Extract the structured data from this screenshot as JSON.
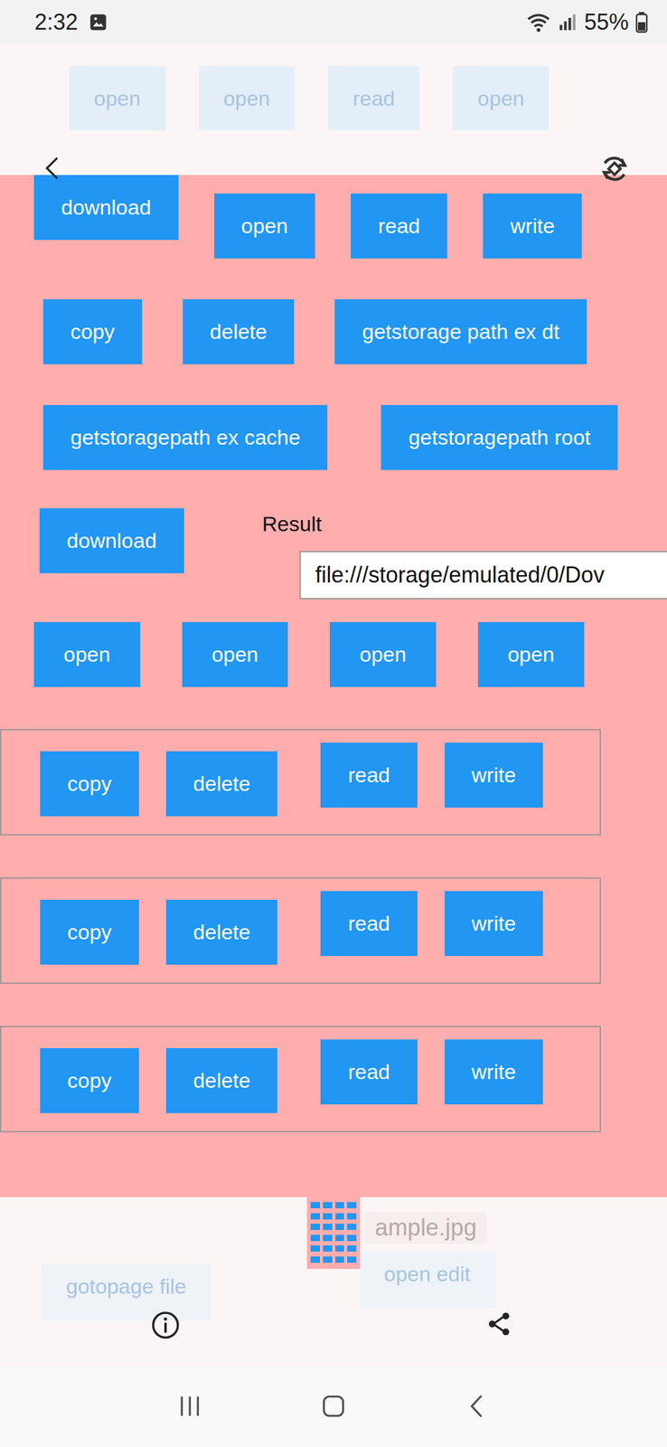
{
  "status_bar": {
    "time": "2:32",
    "battery": "55%"
  },
  "viewer_top": {
    "faded_buttons": [
      "open",
      "open",
      "read",
      "open"
    ]
  },
  "screenshot": {
    "rows": [
      [
        "download",
        "open",
        "read",
        "write"
      ],
      [
        "copy",
        "delete",
        "getstorage path ex dt"
      ],
      [
        "getstoragepath ex cache",
        "getstoragepath root"
      ]
    ],
    "download": "download",
    "result_label": "Result",
    "result_field": "file:///storage/emulated/0/Dov",
    "open_buttons": [
      "open",
      "open",
      "open",
      "open"
    ],
    "groups": [
      [
        "copy",
        "delete",
        "read",
        "write"
      ],
      [
        "copy",
        "delete",
        "read",
        "write"
      ],
      [
        "copy",
        "delete",
        "read",
        "write"
      ]
    ]
  },
  "viewer_bottom": {
    "filename": "ample.jpg",
    "faded_buttons": [
      "gotopage file",
      "open edit"
    ]
  }
}
